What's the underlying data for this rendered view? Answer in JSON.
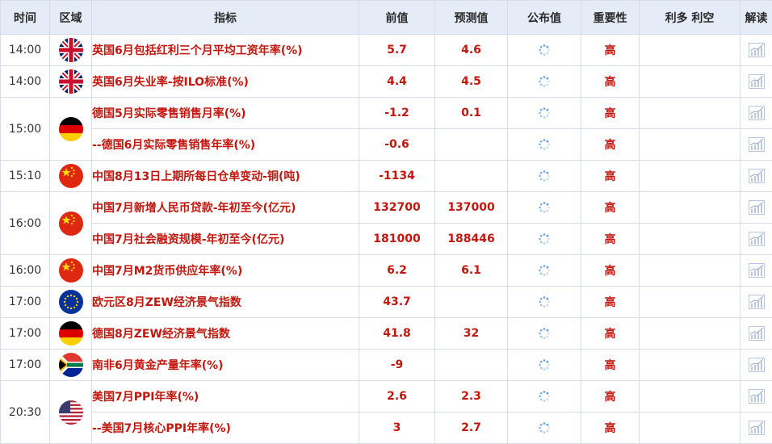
{
  "header": {
    "time": "时间",
    "region": "区域",
    "indicator": "指标",
    "previous": "前值",
    "forecast": "预测值",
    "actual": "公布值",
    "importance": "重要性",
    "impact": "利多 利空",
    "analysis": "解读"
  },
  "colors": {
    "header_bg": "#e5ecf7",
    "indicator_text": "#c2170e",
    "border": "#d6dde8"
  },
  "icons": {
    "loading": "loading-spinner-icon",
    "analysis": "chart-analysis-icon"
  },
  "rows": [
    {
      "time": "14:00",
      "flag": "uk-flag-icon",
      "indicator": "英国6月包括红利三个月平均工资年率(%)",
      "previous": "5.7",
      "forecast": "4.6",
      "importance": "高"
    },
    {
      "time": "14:00",
      "flag": "uk-flag-icon",
      "indicator": "英国6月失业率-按ILO标准(%)",
      "previous": "4.4",
      "forecast": "4.5",
      "importance": "高"
    },
    {
      "time": "15:00",
      "flag": "germany-flag-icon",
      "indicator": "德国5月实际零售销售月率(%)",
      "previous": "-1.2",
      "forecast": "0.1",
      "importance": "高"
    },
    {
      "indicator": "--德国6月实际零售销售年率(%)",
      "previous": "-0.6",
      "forecast": "",
      "importance": "高"
    },
    {
      "time": "15:10",
      "flag": "china-flag-icon",
      "indicator": "中国8月13日上期所每日仓单变动-铜(吨)",
      "previous": "-1134",
      "forecast": "",
      "importance": "高"
    },
    {
      "time": "16:00",
      "flag": "china-flag-icon",
      "indicator": "中国7月新增人民币贷款-年初至今(亿元)",
      "previous": "132700",
      "forecast": "137000",
      "importance": "高"
    },
    {
      "indicator": "中国7月社会融资规模-年初至今(亿元)",
      "previous": "181000",
      "forecast": "188446",
      "importance": "高"
    },
    {
      "time": "16:00",
      "flag": "china-flag-icon",
      "indicator": "中国7月M2货币供应年率(%)",
      "previous": "6.2",
      "forecast": "6.1",
      "importance": "高"
    },
    {
      "time": "17:00",
      "flag": "eu-flag-icon",
      "indicator": "欧元区8月ZEW经济景气指数",
      "previous": "43.7",
      "forecast": "",
      "importance": "高"
    },
    {
      "time": "17:00",
      "flag": "germany-flag-icon",
      "indicator": "德国8月ZEW经济景气指数",
      "previous": "41.8",
      "forecast": "32",
      "importance": "高"
    },
    {
      "time": "17:00",
      "flag": "south-africa-flag-icon",
      "indicator": "南非6月黄金产量年率(%)",
      "previous": "-9",
      "forecast": "",
      "importance": "高"
    },
    {
      "time": "20:30",
      "flag": "usa-flag-icon",
      "indicator": "美国7月PPI年率(%)",
      "previous": "2.6",
      "forecast": "2.3",
      "importance": "高"
    },
    {
      "indicator": "--美国7月核心PPI年率(%)",
      "previous": "3",
      "forecast": "2.7",
      "importance": "高"
    }
  ]
}
